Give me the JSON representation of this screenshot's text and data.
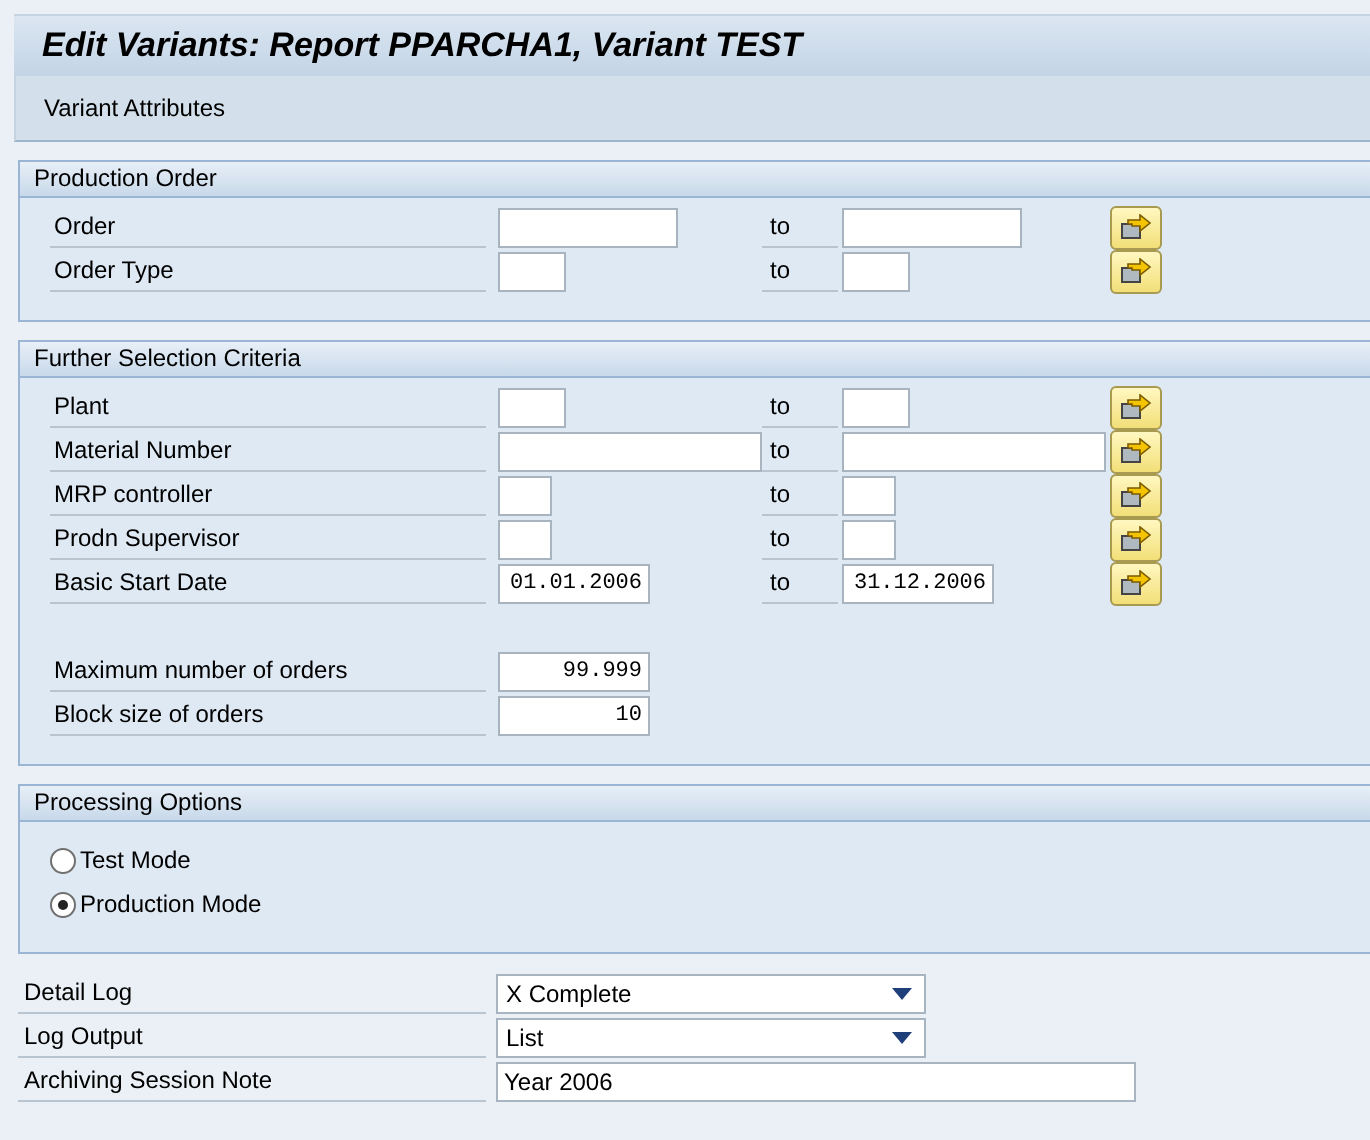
{
  "window": {
    "title": "Edit Variants: Report PPARCHA1, Variant TEST"
  },
  "toolbar": {
    "items": [
      "Variant Attributes"
    ]
  },
  "groups": [
    {
      "title": "Production Order",
      "kind": "selection",
      "rows": [
        {
          "label": "Order",
          "low": "",
          "high": "",
          "to": "to",
          "kind": "long"
        },
        {
          "label": "Order Type",
          "low": "",
          "high": "",
          "to": "to",
          "kind": "short"
        }
      ]
    },
    {
      "title": "Further Selection Criteria",
      "kind": "selection",
      "rows": [
        {
          "label": "Plant",
          "low": "",
          "high": "",
          "to": "to",
          "kind": "short"
        },
        {
          "label": "Material Number",
          "low": "",
          "high": "",
          "to": "to",
          "kind": "wide"
        },
        {
          "label": "MRP controller",
          "low": "",
          "high": "",
          "to": "to",
          "kind": "tiny"
        },
        {
          "label": "Prodn Supervisor",
          "low": "",
          "high": "",
          "to": "to",
          "kind": "tiny"
        },
        {
          "label": "Basic Start Date",
          "low": "01.01.2006",
          "high": "31.12.2006",
          "to": "to",
          "kind": "date"
        },
        {
          "kind": "spacer"
        },
        {
          "label": "Maximum number of orders",
          "low": "99.999",
          "kind": "date"
        },
        {
          "label": "Block size of orders",
          "low": "10",
          "kind": "date"
        }
      ]
    },
    {
      "title": "Processing Options",
      "kind": "radio",
      "options": [
        {
          "label": "Test Mode",
          "selected": false
        },
        {
          "label": "Production Mode",
          "selected": true
        }
      ]
    }
  ],
  "parameters": [
    {
      "label": "Detail Log",
      "kind": "dropdown",
      "value": "X Complete"
    },
    {
      "label": "Log Output",
      "kind": "dropdown",
      "value": "List"
    },
    {
      "label": "Archiving Session Note",
      "kind": "input",
      "value": "Year 2006"
    }
  ]
}
